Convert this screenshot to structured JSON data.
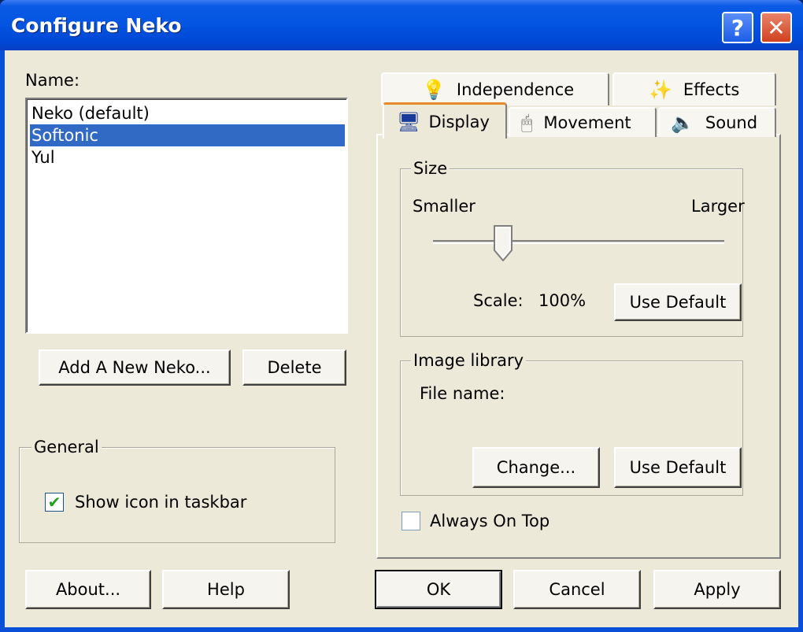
{
  "window": {
    "title": "Configure Neko",
    "help_label": "?",
    "close_label": "✕"
  },
  "left": {
    "name_label": "Name:",
    "list_items": [
      "Neko (default)",
      "Softonic",
      "Yul"
    ],
    "selected_index": 1,
    "add_button": "Add A New Neko...",
    "delete_button": "Delete",
    "general_label": "General",
    "show_icon_label": "Show icon in taskbar",
    "show_icon_checked": true
  },
  "tabs": {
    "row1": [
      {
        "label": "Independence",
        "icon": "lightbulb-icon"
      },
      {
        "label": "Effects",
        "icon": "sparkle-icon"
      }
    ],
    "row2": [
      {
        "label": "Display",
        "icon": "monitor-icon"
      },
      {
        "label": "Movement",
        "icon": "mouse-icon"
      },
      {
        "label": "Sound",
        "icon": "speaker-icon"
      }
    ],
    "active": "Display"
  },
  "display": {
    "size_label": "Size",
    "smaller_label": "Smaller",
    "larger_label": "Larger",
    "slider_value_fraction": 0.24,
    "scale_label": "Scale:",
    "scale_value": "100%",
    "use_default_label": "Use Default",
    "image_library_label": "Image library",
    "file_name_label": "File name:",
    "change_button": "Change...",
    "use_default2_label": "Use Default",
    "always_on_top_label": "Always On Top",
    "always_on_top_checked": false
  },
  "footer": {
    "about": "About...",
    "help": "Help",
    "ok": "OK",
    "cancel": "Cancel",
    "apply": "Apply"
  },
  "colors": {
    "title_blue": "#0354e0",
    "face": "#ece9d8",
    "selection": "#316ac5",
    "check_green": "#21a121"
  }
}
